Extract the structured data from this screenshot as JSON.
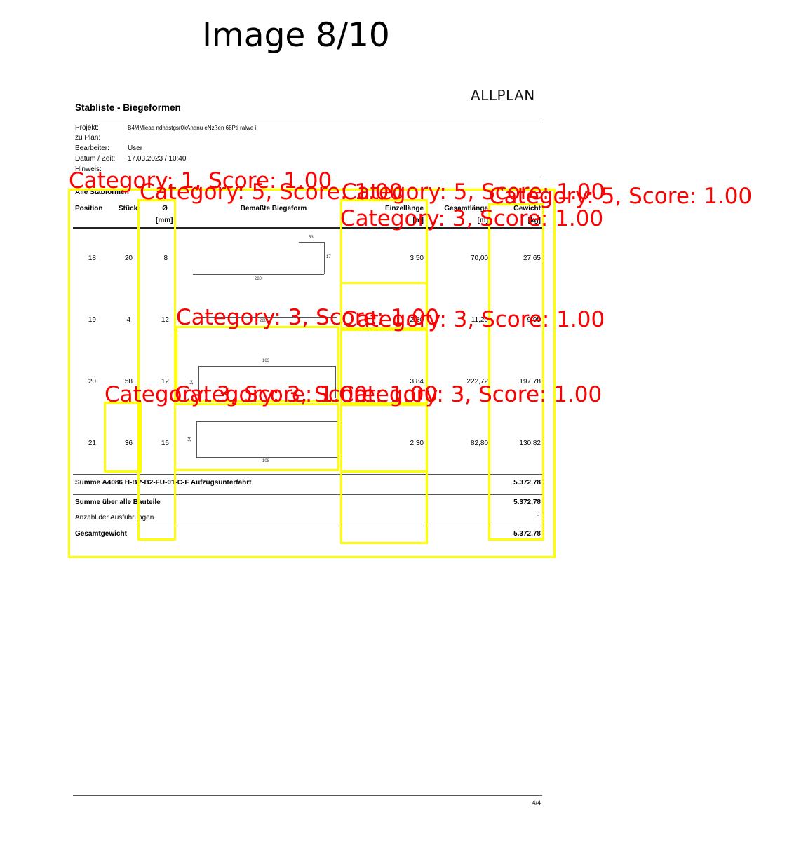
{
  "figure_title": "Image 8/10",
  "doc": {
    "logo": "ALLPLAN",
    "title": "Stabliste - Biegeformen",
    "meta": [
      {
        "label": "Projekt:",
        "value": "B4MMieaa ndhastgsr0kAnanu eNzßen 68Pti ralwe i"
      },
      {
        "label": "zu Plan:",
        "value": ""
      },
      {
        "label": "Bearbeiter:",
        "value": "User"
      },
      {
        "label": "Datum / Zeit:",
        "value": "17.03.2023  /  10:40"
      },
      {
        "label": "Hinweis:",
        "value": ""
      }
    ],
    "section_label": "Alle Stabformen",
    "headers": {
      "position": "Position",
      "stueck": "Stück",
      "diameter": "Ø",
      "diameter_unit": "[mm]",
      "form": "Bemaßte Biegeform",
      "einzellaenge": "Einzellänge",
      "einzellaenge_unit": "[m]",
      "gesamtlaenge": "Gesamtlänge",
      "gesamtlaenge_unit": "[m]",
      "gewicht": "Gewicht",
      "gewicht_unit": "[kg]"
    },
    "rows": [
      {
        "position": "18",
        "stueck": "20",
        "diameter": "8",
        "einzel": "3.50",
        "gesamt": "70,00",
        "gewicht": "27,65",
        "dims": [
          "53",
          "17",
          "280"
        ]
      },
      {
        "position": "19",
        "stueck": "4",
        "diameter": "12",
        "einzel": "2.80",
        "gesamt": "11,20",
        "gewicht": "9,95",
        "dims": [
          "280"
        ]
      },
      {
        "position": "20",
        "stueck": "58",
        "diameter": "12",
        "einzel": "3.84",
        "gesamt": "222,72",
        "gewicht": "197,78",
        "dims": [
          "163",
          "14"
        ]
      },
      {
        "position": "21",
        "stueck": "36",
        "diameter": "16",
        "einzel": "2.30",
        "gesamt": "82,80",
        "gewicht": "130,82",
        "dims": [
          "14",
          "108"
        ]
      }
    ],
    "summary": [
      {
        "label": "Summe A4086 H-BP-B2-FU-01-C-F Aufzugsunterfahrt",
        "value": "5.372,78",
        "bold": true
      },
      {
        "label": "Summe über alle Bauteile",
        "value": "5.372,78",
        "bold": true
      },
      {
        "label": "Anzahl der Ausführungen",
        "value": "1",
        "bold": false
      },
      {
        "label": "Gesamtgewicht",
        "value": "5.372,78",
        "bold": true
      }
    ],
    "page_number": "4/4"
  },
  "annotations": [
    {
      "label": "Category: 1, Score: 1.00"
    },
    {
      "label": "Category: 5, Score: 1.00"
    },
    {
      "label": "Category: 5, Score: 1.00"
    },
    {
      "label": "Category: 5, Score: 1.00"
    },
    {
      "label": "Category: 3, Score: 1.00"
    },
    {
      "label": "Category: 3, Score: 1.00"
    },
    {
      "label": "Category: 3, Score: 1.00"
    },
    {
      "label": "Category: 3, Score: 1.00"
    },
    {
      "label": "Category: 3, Score: 1.00"
    },
    {
      "label": "Category: 3, Score: 1.00"
    }
  ],
  "colors": {
    "box": "#ffff00",
    "label": "#ff0000"
  }
}
